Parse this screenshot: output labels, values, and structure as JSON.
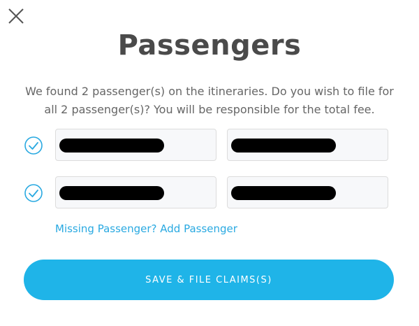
{
  "dialog": {
    "close_icon": "close-icon",
    "title": "Passengers",
    "message": "We found 2 passenger(s) on the itineraries. Do you wish to file for all 2 passenger(s)? You will be responsible for the total fee."
  },
  "passengers": [
    {
      "checked": true,
      "first_name": "[redacted]",
      "last_name": "[redacted]"
    },
    {
      "checked": true,
      "first_name": "[redacted]",
      "last_name": "[redacted]"
    }
  ],
  "links": {
    "add_passenger": "Missing Passenger? Add Passenger"
  },
  "actions": {
    "save_label": "SAVE & FILE CLAIMS(S)"
  },
  "colors": {
    "accent": "#1fb4e8",
    "link": "#29a9e1",
    "title": "#4a4a4a",
    "field_bg": "#f7f8fa"
  }
}
